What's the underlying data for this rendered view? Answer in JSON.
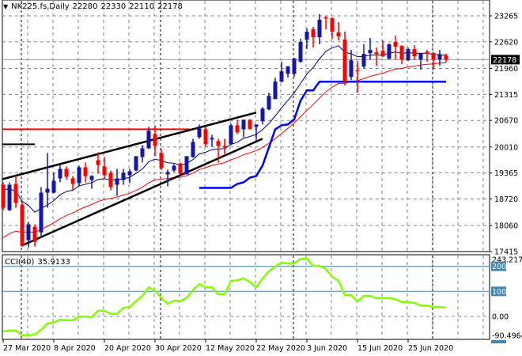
{
  "header": {
    "symbol": "NK225.fs,Daily",
    "open": "22280",
    "high": "22330",
    "low": "22110",
    "close": "22178",
    "menu_icon": "triangle-down-icon"
  },
  "indicator": {
    "name": "CCI(40)",
    "value": "35.9133"
  },
  "colors": {
    "bull": "#1515a8",
    "bear": "#ff0000",
    "fast_ma": "#000080",
    "slow_ma": "#ff0000",
    "support_line": "#0000ff",
    "trendline": "#000000",
    "resistance": "#ff0000",
    "cci": "#7fff00",
    "grid": "#7a8794",
    "level": "#4682b4"
  },
  "chart_data": [
    {
      "type": "candlestick",
      "title": "NK225.fs,Daily",
      "ylim": [
        17415,
        23265
      ],
      "y_ticks": [
        "23265",
        "22620",
        "21960",
        "21315",
        "20670",
        "20010",
        "19365",
        "18720",
        "18060",
        "17415"
      ],
      "current_price_label": "22178",
      "x_labels": [
        {
          "index": 0,
          "text": "27 Mar 2020"
        },
        {
          "index": 8,
          "text": "8 Apr 2020"
        },
        {
          "index": 16,
          "text": "20 Apr 2020"
        },
        {
          "index": 24,
          "text": "30 Apr 2020"
        },
        {
          "index": 32,
          "text": "12 May 2020"
        },
        {
          "index": 40,
          "text": "22 May 2020"
        },
        {
          "index": 48,
          "text": "3 Jun 2020"
        },
        {
          "index": 56,
          "text": "15 Jun 2020"
        },
        {
          "index": 64,
          "text": "25 Jun 2020"
        }
      ],
      "period_separators": [
        3,
        25,
        46,
        68
      ],
      "ohlc": [
        [
          19073,
          19132,
          18443,
          18502
        ],
        [
          18443,
          19132,
          18423,
          19073
        ],
        [
          19093,
          19309,
          18502,
          18621
        ],
        [
          18581,
          18640,
          17538,
          17558
        ],
        [
          17696,
          18148,
          17519,
          18089
        ],
        [
          18030,
          18089,
          17538,
          17656
        ],
        [
          17892,
          19014,
          17755,
          18876
        ],
        [
          18876,
          19860,
          18502,
          18975
        ],
        [
          18876,
          19368,
          18857,
          19172
        ],
        [
          19231,
          19585,
          19132,
          19467
        ],
        [
          19467,
          19526,
          19191,
          19270
        ],
        [
          19231,
          19290,
          18916,
          19093
        ],
        [
          19113,
          19545,
          19054,
          19506
        ],
        [
          19506,
          19624,
          19132,
          19290
        ],
        [
          19191,
          19309,
          18975,
          19290
        ],
        [
          19683,
          19880,
          19349,
          19565
        ],
        [
          19526,
          19762,
          19211,
          19309
        ],
        [
          19368,
          19427,
          18935,
          19014
        ],
        [
          19073,
          19467,
          18798,
          19231
        ],
        [
          19191,
          19467,
          19073,
          19368
        ],
        [
          19309,
          19467,
          19113,
          19408
        ],
        [
          19427,
          19782,
          19408,
          19782
        ],
        [
          19762,
          20057,
          19624,
          19978
        ],
        [
          19978,
          20510,
          19959,
          20412
        ],
        [
          20333,
          20549,
          19782,
          20038
        ],
        [
          19860,
          19959,
          19447,
          19487
        ],
        [
          19329,
          19447,
          19034,
          19388
        ],
        [
          19427,
          19585,
          19388,
          19545
        ],
        [
          19604,
          19624,
          19329,
          19349
        ],
        [
          19329,
          19782,
          19329,
          19782
        ],
        [
          19762,
          20215,
          19742,
          20136
        ],
        [
          20254,
          20569,
          20215,
          20471
        ],
        [
          20451,
          20510,
          20018,
          20077
        ],
        [
          20195,
          20313,
          20018,
          20234
        ],
        [
          20156,
          20215,
          19624,
          20038
        ],
        [
          20038,
          20215,
          19801,
          19998
        ],
        [
          20077,
          20589,
          20057,
          20549
        ],
        [
          20549,
          20687,
          20333,
          20372
        ],
        [
          20451,
          20687,
          20254,
          20687
        ],
        [
          20687,
          20700,
          20451,
          20451
        ],
        [
          20510,
          20569,
          20175,
          20569
        ],
        [
          20648,
          21002,
          20569,
          20962
        ],
        [
          20943,
          21356,
          20923,
          21277
        ],
        [
          21199,
          21730,
          21199,
          21632
        ],
        [
          21632,
          22124,
          21612,
          21887
        ],
        [
          21828,
          22025,
          21730,
          22006
        ],
        [
          21828,
          22222,
          21750,
          22202
        ],
        [
          22124,
          22694,
          22104,
          22616
        ],
        [
          22675,
          22950,
          22439,
          22871
        ],
        [
          22930,
          22990,
          22478,
          22734
        ],
        [
          22734,
          23304,
          22557,
          23167
        ],
        [
          23226,
          23265,
          22930,
          23206
        ],
        [
          23206,
          23226,
          22694,
          22871
        ],
        [
          22852,
          23108,
          22655,
          22753
        ],
        [
          22675,
          22871,
          21533,
          21632
        ],
        [
          21750,
          22419,
          21671,
          22163
        ],
        [
          21927,
          22143,
          21356,
          21907
        ],
        [
          22006,
          22557,
          21966,
          22320
        ],
        [
          22340,
          22714,
          22183,
          22419
        ],
        [
          22360,
          22478,
          22025,
          22320
        ],
        [
          22399,
          22655,
          22242,
          22261
        ],
        [
          22202,
          22576,
          22183,
          22557
        ],
        [
          22616,
          22773,
          22183,
          22498
        ],
        [
          22517,
          22537,
          22064,
          22183
        ],
        [
          22163,
          22478,
          22143,
          22439
        ],
        [
          22439,
          22537,
          22163,
          22261
        ],
        [
          22183,
          22340,
          21927,
          22340
        ],
        [
          22379,
          22419,
          22124,
          22320
        ],
        [
          22340,
          22360,
          21927,
          22183
        ],
        [
          22183,
          22419,
          22025,
          22301
        ],
        [
          22280,
          22330,
          22110,
          22178
        ]
      ],
      "support_line": {
        "start_index": 31,
        "values": [
          18995,
          18995,
          18995,
          18995,
          18995,
          18995,
          19093,
          19132,
          19250,
          19290,
          19550,
          20000,
          20450,
          20550,
          20570,
          20700,
          21160,
          21415,
          21415,
          21632,
          21632,
          21632,
          21632,
          21632,
          21632,
          21632,
          21632,
          21632,
          21632,
          21632,
          21632,
          21632,
          21632,
          21632,
          21632,
          21632,
          21632,
          21632,
          21632,
          21632
        ]
      },
      "trendlines": [
        {
          "name": "upper-channel",
          "from": [
            0,
            19211
          ],
          "to": [
            40,
            20864
          ]
        },
        {
          "name": "lower-channel",
          "from": [
            3,
            17558
          ],
          "to": [
            41,
            20215
          ]
        }
      ],
      "horizontal_levels": [
        {
          "name": "resistance",
          "price": 20451,
          "from": 0,
          "to": 29.5
        },
        {
          "name": "prior-level",
          "price": 20077,
          "from": 0,
          "to": 5
        }
      ]
    },
    {
      "type": "line",
      "title": "CCI(40)",
      "ylim": [
        -90.4964,
        243.2176
      ],
      "y_labels": [
        "243.2176",
        "200",
        "100",
        "0.00",
        "-90.4964"
      ],
      "levels": [
        200,
        100
      ],
      "values": [
        -60,
        -56,
        -56,
        -75,
        -75,
        -72,
        -53,
        -28,
        -24,
        -13,
        -15,
        -15,
        0,
        0,
        -3,
        23,
        23,
        10,
        10,
        34,
        38,
        61,
        82,
        116,
        103,
        74,
        50,
        63,
        61,
        74,
        105,
        129,
        116,
        116,
        89,
        89,
        142,
        144,
        152,
        137,
        116,
        152,
        180,
        199,
        215,
        211,
        211,
        230,
        230,
        202,
        202,
        189,
        158,
        142,
        85,
        85,
        60,
        82,
        82,
        73,
        73,
        73,
        69,
        57,
        57,
        54,
        44,
        44,
        38,
        38,
        35.9133
      ]
    }
  ]
}
